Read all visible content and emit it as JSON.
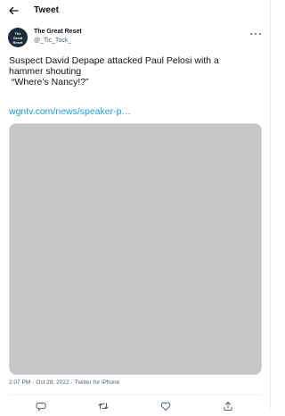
{
  "header": {
    "title": "Tweet",
    "back_icon": "arrow-left-icon"
  },
  "author": {
    "display_name": "The Great Reset",
    "handle": "@_Tic_Tock_",
    "avatar_text": [
      "The",
      "Great",
      "Reset"
    ]
  },
  "tweet": {
    "lines": [
      "Suspect David Depape attacked Paul Pelosi with a",
      "hammer shouting",
      " “Where’s Nancy!?”"
    ],
    "link": "wgntv.com/news/speaker-p…",
    "image": {
      "background": "#c8c6c4"
    }
  },
  "meta": {
    "time": "2:07 PM",
    "separator": "·",
    "date": "Oct 28, 2022",
    "source": "Twitter for iPhone"
  },
  "actions": [
    {
      "name": "reply-icon"
    },
    {
      "name": "retweet-icon"
    },
    {
      "name": "like-icon"
    },
    {
      "name": "share-icon"
    }
  ],
  "colors": {
    "link": "#1d9bf0",
    "secondary_text": "#536471",
    "border": "#cfd9de"
  }
}
